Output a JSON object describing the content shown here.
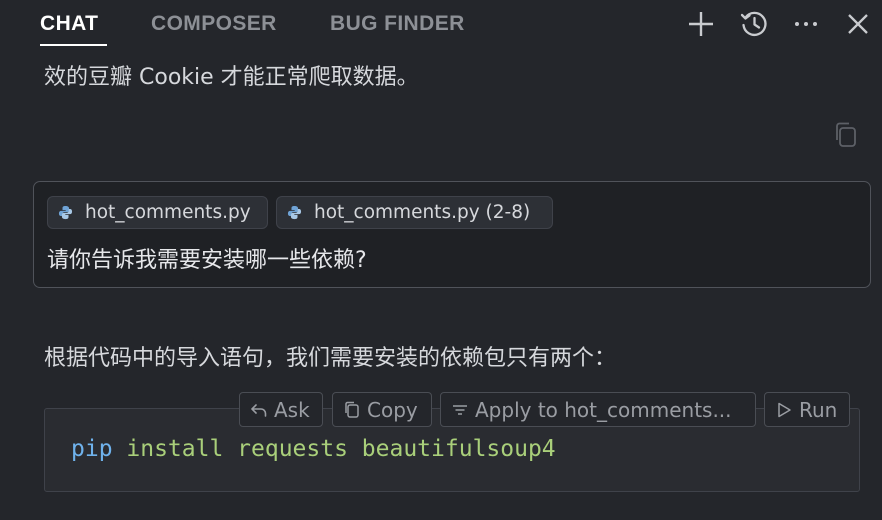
{
  "tabs": [
    {
      "label": "CHAT",
      "active": true
    },
    {
      "label": "COMPOSER",
      "active": false
    },
    {
      "label": "BUG FINDER",
      "active": false
    }
  ],
  "toolbar_icons": [
    "plus-icon",
    "history-icon",
    "more-icon",
    "close-icon"
  ],
  "messages": {
    "ai_previous_tail": "效的豆瓣 Cookie 才能正常爬取数据。",
    "user": {
      "attachments": [
        {
          "label": "hot_comments.py",
          "icon": "python-icon"
        },
        {
          "label": "hot_comments.py (2-8)",
          "icon": "python-icon"
        }
      ],
      "text": "请你告诉我需要安装哪一些依赖?"
    },
    "ai_answer_intro": "根据代码中的导入语句，我们需要安装的依赖包只有两个："
  },
  "code_block": {
    "tokens": [
      {
        "text": "pip",
        "kind": "cmd"
      },
      {
        "text": " install requests beautifulsoup4",
        "kind": "arg"
      }
    ],
    "actions": {
      "ask": "Ask",
      "copy": "Copy",
      "apply": "Apply to hot_comments...",
      "run": "Run"
    }
  },
  "colors": {
    "background": "#24262b",
    "card_bg": "#1f2125",
    "code_cmd": "#6fb2ec",
    "code_arg": "#a9cf7a",
    "tab_active": "#ffffff",
    "tab_inactive": "#8d9096"
  }
}
